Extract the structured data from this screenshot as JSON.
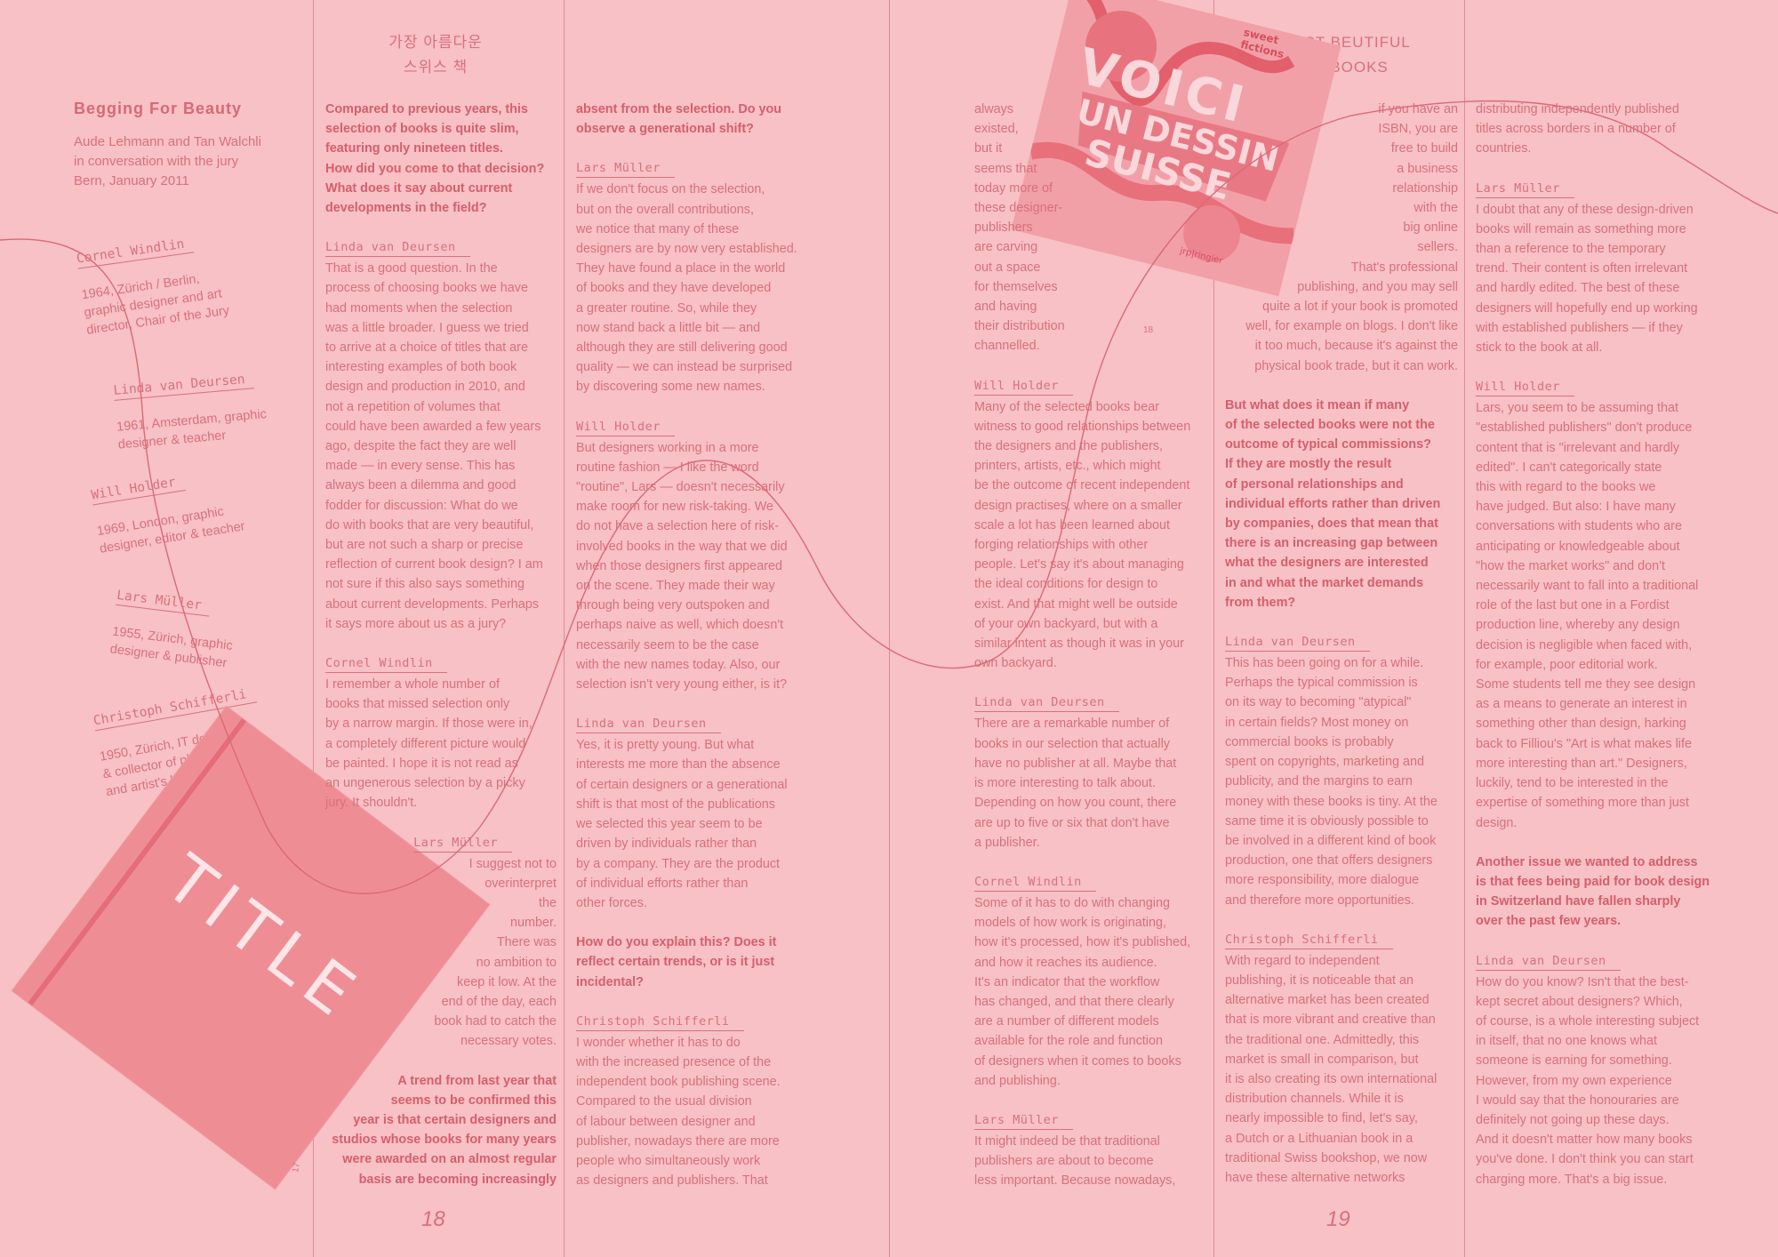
{
  "spread": {
    "left_page_number": "18",
    "right_page_number": "19",
    "title_kr_line1": "가장 아름다운",
    "title_kr_line2": "스위스 책",
    "title_en_line1": "OST BEUTIFUL",
    "title_en_line2": "S BOOKS"
  },
  "intro": {
    "heading": "Begging For Beauty",
    "text": "Aude Lehmann and Tan Walchli\nin conversation with the jury\nBern, January 2011"
  },
  "jury": [
    {
      "name": "Cornel Windlin",
      "bio": "1964, Zürich / Berlin,\ngraphic designer and art\ndirector, Chair of the Jury"
    },
    {
      "name": "Linda van Deursen",
      "bio": "1961, Amsterdam, graphic\ndesigner & teacher"
    },
    {
      "name": "Will Holder",
      "bio": "1969, London, graphic\ndesigner, editor & teacher"
    },
    {
      "name": "Lars Müller",
      "bio": "1955, Zürich, graphic\ndesigner & publisher"
    },
    {
      "name": "Christoph Schifferli",
      "bio": "1950, Zürich, IT developer\n& collector of photography\nand artist's books etc."
    }
  ],
  "images": {
    "book_title": "TITLE",
    "book_page_marker": "17",
    "cover_text_1": "VOICI",
    "cover_text_2": "UN DESSIN",
    "cover_text_3": "SUISSE",
    "cover_top_text": "sweet\nfictions",
    "cover_bottom_text": "jrp|ringier",
    "cover_page_marker": "18"
  },
  "col1": {
    "q1": "Compared to previous years, this\nselection of books is quite slim,\nfeaturing only nineteen titles.\nHow did you come to that decision?\nWhat does it say about current\ndevelopments in the field?",
    "s1": "Linda van Deursen",
    "a1": "That is a good question. In the\nprocess of choosing books we have\nhad moments when the selection\nwas a little broader. I guess we tried\nto arrive at a choice of titles that are\ninteresting examples of both book\ndesign and production in 2010, and\nnot a repetition of volumes that\ncould have been awarded a few years\nago, despite the fact they are well\nmade — in every sense. This has\nalways been a dilemma and good\nfodder for discussion: What do we\ndo with books that are very beautiful,\nbut are not such a sharp or precise\nreflection of current book design? I am\nnot sure if this also says something\nabout current developments. Perhaps\nit says more about us as a jury?",
    "s2": "Cornel Windlin",
    "a2": "I remember a whole number of\nbooks that missed selection only\nby a narrow margin. If those were in,\na completely different picture would\nbe painted. I hope it is not read as\nan ungenerous selection by a picky\njury. It shouldn't.",
    "s3": "Lars Müller",
    "a3": "I suggest not to\noverinterpret\nthe\nnumber.\nThere was\nno ambition to\nkeep it low. At the\nend of the day, each\nbook had to catch the\nnecessary votes.",
    "q2": "A trend from last year that\nseems to be confirmed this\nyear is that certain designers and\nstudios whose books for many years\nwere awarded on an almost regular\nbasis are becoming increasingly"
  },
  "col2": {
    "q1": "absent from the selection. Do you\nobserve a generational shift?",
    "s1": "Lars Müller",
    "a1": "If we don't focus on the selection,\nbut on the overall contributions,\nwe notice that many of these\ndesigners are by now very established.\nThey have found a place in the world\nof books and they have developed\na greater routine. So, while they\nnow stand back a little bit — and\nalthough they are still delivering good\nquality — we can instead be surprised\nby discovering some new names.",
    "s2": "Will Holder",
    "a2": "But designers working in a more\nroutine fashion — I like the word\n\"routine\", Lars — doesn't necessarily\nmake room for new risk-taking. We\ndo not have a selection here of risk-\ninvolved books in the way that we did\nwhen those designers first appeared\non the scene. They made their way\nthrough being very outspoken and\nperhaps naive as well, which doesn't\nnecessarily seem to be the case\nwith the new names today. Also, our\nselection isn't very young either, is it?",
    "s3": "Linda van Deursen",
    "a3": "Yes, it is pretty young. But what\ninterests me more than the absence\nof certain designers or a generational\nshift is that most of the publications\nwe selected this year seem to be\ndriven by individuals rather than\nby a company. They are the product\nof individual efforts rather than\nother forces.",
    "q2": "How do you explain this? Does it\nreflect certain trends, or is it just\nincidental?",
    "s4": "Christoph Schifferli",
    "a4": "I wonder whether it has to do\nwith the increased presence of the\nindependent book publishing scene.\nCompared to the usual division\nof labour between designer and\npublisher, nowadays there are more\npeople who simultaneously work\nas designers and publishers. That"
  },
  "col3": {
    "a0": "always\nexisted,\nbut it\nseems that\ntoday more of\nthese designer-\npublishers\nare carving\nout a space\nfor themselves\nand having\ntheir distribution\nchannelled.",
    "s1": "Will Holder",
    "a1": "Many of the selected books bear\nwitness to good relationships between\nthe designers and the publishers,\nprinters, artists, etc., which might\nbe the outcome of recent independent\ndesign practises, where on a smaller\nscale a lot has been learned about\nforging relationships with other\npeople. Let's say it's about managing\nthe ideal conditions for design to\nexist. And that might well be outside\nof your own backyard, but with a\nsimilar intent as though it was in your\nown backyard.",
    "s2": "Linda van Deursen",
    "a2": "There are a remarkable number of\nbooks in our selection that actually\nhave no publisher at all. Maybe that\nis more interesting to talk about.\nDepending on how you count, there\nare up to five or six that don't have\na publisher.",
    "s3": "Cornel Windlin",
    "a3": "Some of it has to do with changing\nmodels of how work is originating,\nhow it's processed, how it's published,\nand how it reaches its audience.\nIt's an indicator that the workflow\nhas changed, and that there clearly\nare a number of different models\navailable for the role and function\nof designers when it comes to books\nand publishing.",
    "s4": "Lars Müller",
    "a4": "It might indeed be that traditional\npublishers are about to become\nless important. Because nowadays,"
  },
  "col4": {
    "a0": "if you have an\nISBN, you are\nfree to build\na business\nrelationship\nwith the\nbig online\nsellers.\nThat's professional\npublishing, and you may sell\nquite a lot if your book is promoted\nwell, for example on blogs. I don't like\nit too much, because it's against the\nphysical book trade, but it can work.",
    "q1": "But what does it mean if many\nof the selected books were not the\noutcome of typical commissions?\nIf they are mostly the result\nof personal relationships and\nindividual efforts rather than driven\nby companies, does that mean that\nthere is an increasing gap between\nwhat the designers are interested\nin and what the market demands\nfrom them?",
    "s1": "Linda van Deursen",
    "a1": "This has been going on for a while.\nPerhaps the typical commission is\non its way to becoming \"atypical\"\nin certain fields? Most money on\ncommercial books is probably\nspent on copyrights, marketing and\npublicity, and the margins to earn\nmoney with these books is tiny. At the\nsame time it is obviously possible to\nbe involved in a different kind of book\nproduction, one that offers designers\nmore responsibility, more dialogue\nand therefore more opportunities.",
    "s2": "Christoph Schifferli",
    "a2": "With regard to independent\npublishing, it is noticeable that an\nalternative market has been created\nthat is more vibrant and creative than\nthe traditional one. Admittedly, this\nmarket is small in comparison, but\nit is also creating its own international\ndistribution channels. While it is\nnearly impossible to find, let's say,\na Dutch or a Lithuanian book in a\ntraditional Swiss bookshop, we now\nhave these alternative networks"
  },
  "col5": {
    "a0": "distributing independently published\ntitles across borders in a number of\ncountries.",
    "s1": "Lars Müller",
    "a1": "I doubt that any of these design-driven\nbooks will remain as something more\nthan a reference to the temporary\ntrend. Their content is often irrelevant\nand hardly edited. The best of these\ndesigners will hopefully end up working\nwith established publishers — if they\nstick to the book at all.",
    "s2": "Will Holder",
    "a2": "Lars, you seem to be assuming that\n\"established publishers\" don't produce\ncontent that is \"irrelevant and hardly\nedited\". I can't categorically state\nthis with regard to the books we\nhave judged. But also: I have many\nconversations with students who are\nanticipating or knowledgeable about\n\"how the market works\" and don't\nnecessarily want to fall into a traditional\nrole of the last but one in a Fordist\nproduction line, whereby any design\ndecision is negligible when faced with,\nfor example, poor editorial work.\nSome students tell me they see design\nas a means to generate an interest in\nsomething other than design, harking\nback to Filliou's \"Art is what makes life\nmore interesting than art.\" Designers,\nluckily, tend to be interested in the\nexpertise of something more than just\ndesign.",
    "q1": "Another issue we wanted to address\nis that fees being paid for book design\nin Switzerland have fallen sharply\nover the past few years.",
    "s3": "Linda van Deursen",
    "a3": "How do you know? Isn't that the best-\nkept secret about designers? Which,\nof course, is a whole interesting subject\nin itself, that no one knows what\nsomeone is earning for something.\nHowever, from my own experience\nI would say that the honouraries are\ndefinitely not going up these days.\nAnd it doesn't matter how many books\nyou've done. I don't think you can start\ncharging more. That's a big issue."
  }
}
